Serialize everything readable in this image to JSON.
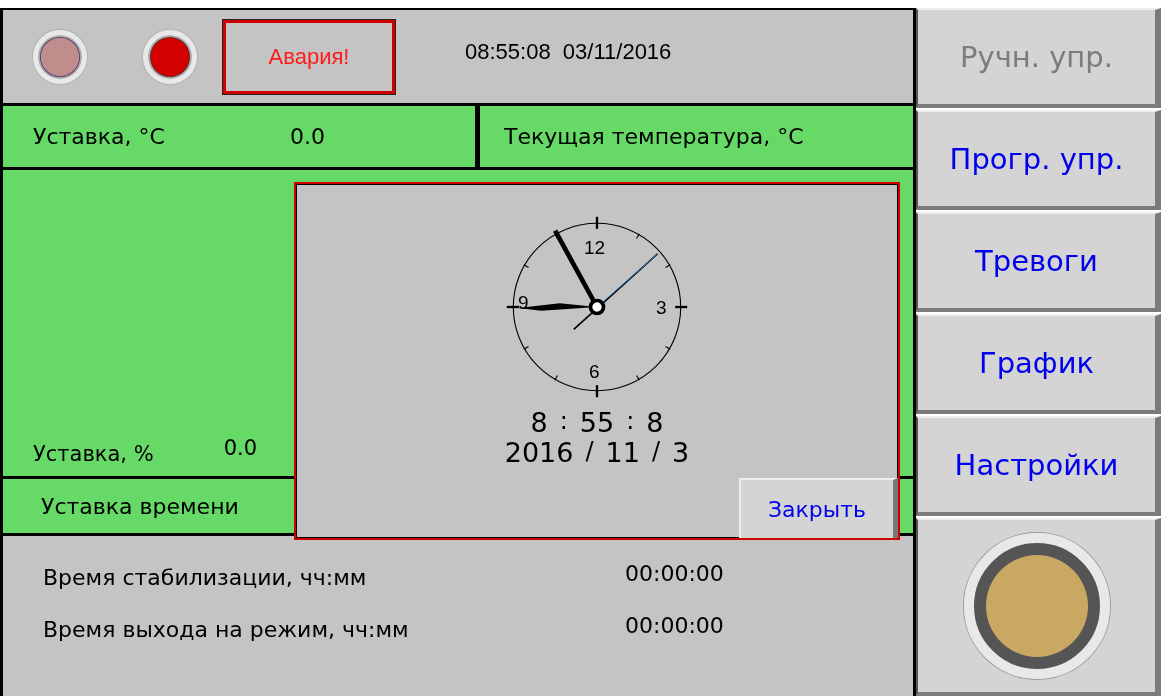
{
  "header": {
    "lamps": [
      {
        "on": false
      },
      {
        "on": true
      }
    ],
    "alarm_label": "Авария!",
    "datetime": "08:55:08  03/11/2016"
  },
  "setpoint_row": {
    "label": "Уставка, °C",
    "value": "0.0",
    "current_label": "Текущая температура, °C"
  },
  "power_panel": {
    "label": "Уставка, %",
    "value": "0.0"
  },
  "time_row": {
    "label": "Уставка времени"
  },
  "times": [
    {
      "label": "Время стабилизации, чч:мм",
      "value": "00:00:00"
    },
    {
      "label": "Время выхода на режим, чч:мм",
      "value": "00:00:00"
    }
  ],
  "clock_dialog": {
    "dial_numbers": [
      "12",
      "3",
      "6",
      "9"
    ],
    "time": [
      "8",
      ":",
      "55",
      ":",
      "8"
    ],
    "date": [
      "2016",
      "/",
      "11",
      "/",
      "3"
    ],
    "close_button": "Закрыть"
  },
  "sidebar": {
    "buttons": [
      {
        "label": "Ручн. упр.",
        "disabled": true
      },
      {
        "label": "Прогр. упр.",
        "disabled": false
      },
      {
        "label": "Тревоги",
        "disabled": false
      },
      {
        "label": "График",
        "disabled": false
      },
      {
        "label": "Настройки",
        "disabled": false
      }
    ],
    "lamp": {
      "on": true
    }
  }
}
